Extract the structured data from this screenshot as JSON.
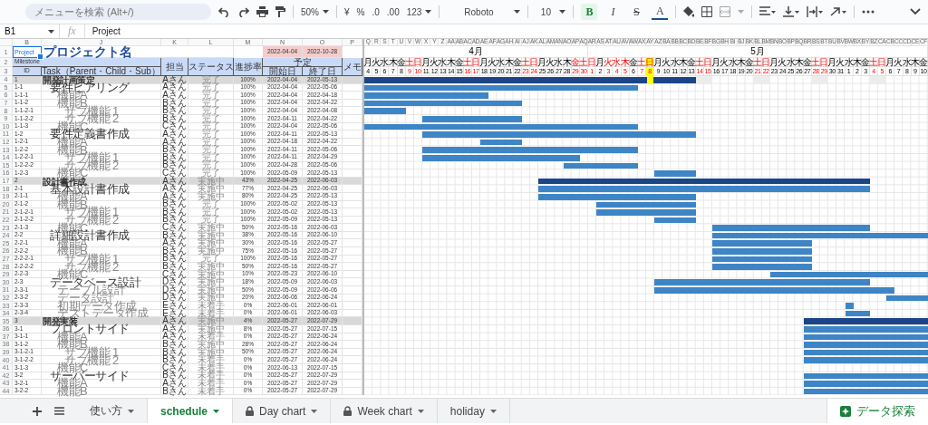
{
  "toolbar": {
    "search_placeholder": "メニューを検索 (Alt+/)",
    "zoom": "50%",
    "number_formats": [
      "¥",
      "%",
      ".0",
      ".00",
      "123"
    ],
    "font": "Roboto",
    "font_size": "10",
    "styles": [
      {
        "kind": "bold",
        "label": "B",
        "on": true
      },
      {
        "kind": "italic",
        "label": "I",
        "on": false
      },
      {
        "kind": "strike",
        "label": "S",
        "on": false
      },
      {
        "kind": "color",
        "label": "A",
        "on": false
      }
    ]
  },
  "formula_bar": {
    "cell": "B1",
    "fx": "fx",
    "value": "Project"
  },
  "column_letters": [
    "B",
    "J",
    "K",
    "L",
    "M",
    "N",
    "O",
    "P"
  ],
  "header": {
    "row_numbers": [
      "1",
      "2",
      "3"
    ],
    "cell": "Project",
    "title": "プロジェクト名",
    "start": "2022-04-04",
    "end": "2022-10-28",
    "milestone": "Milestone",
    "plan": "予定",
    "columns": [
      "ID",
      "Task（Parent・Child・Sub）",
      "担当",
      "ステータス",
      "進捗率",
      "開始日",
      "終了日",
      "メモ"
    ]
  },
  "tasks": [
    {
      "row": "4",
      "id": "1",
      "task": "開発計画策定",
      "owner": "Aさん",
      "status": "完了",
      "progress": "100%",
      "start": "2022-04-04",
      "end": "2022-05-13",
      "children": [
        {
          "row": "5",
          "id": "1-1",
          "task": "要件ヒアリング",
          "owner": "Aさん",
          "status": "完了",
          "progress": "100%",
          "start": "2022-04-04",
          "end": "2022-05-06",
          "children": [
            {
              "row": "6",
              "id": "1-1-1",
              "task": "機能A",
              "owner": "Aさん",
              "status": "完了",
              "progress": "100%",
              "start": "2022-04-04",
              "end": "2022-04-18"
            },
            {
              "row": "7",
              "id": "1-1-2",
              "task": "機能B",
              "owner": "Bさん",
              "status": "完了",
              "progress": "100%",
              "start": "2022-04-04",
              "end": "2022-04-22",
              "children": [
                {
                  "row": "8",
                  "id": "1-1-2-1",
                  "task": "サブ機能 1",
                  "owner": "Bさん",
                  "status": "完了",
                  "progress": "100%",
                  "start": "2022-04-04",
                  "end": "2022-04-08"
                },
                {
                  "row": "9",
                  "id": "1-1-2-2",
                  "task": "サブ機能 2",
                  "owner": "Bさん",
                  "status": "完了",
                  "progress": "100%",
                  "start": "2022-04-11",
                  "end": "2022-04-22"
                }
              ]
            },
            {
              "row": "10",
              "id": "1-1-3",
              "task": "機能C",
              "owner": "Cさん",
              "status": "完了",
              "progress": "100%",
              "start": "2022-04-04",
              "end": "2022-05-06"
            }
          ]
        },
        {
          "row": "11",
          "id": "1-2",
          "task": "要件定義書作成",
          "owner": "Aさん",
          "status": "完了",
          "progress": "100%",
          "start": "2022-04-11",
          "end": "2022-05-13",
          "children": [
            {
              "row": "12",
              "id": "1-2-1",
              "task": "機能A",
              "owner": "Aさん",
              "status": "完了",
              "progress": "100%",
              "start": "2022-04-18",
              "end": "2022-04-22"
            },
            {
              "row": "13",
              "id": "1-2-2",
              "task": "機能B",
              "owner": "Bさん",
              "status": "完了",
              "progress": "100%",
              "start": "2022-04-11",
              "end": "2022-05-06",
              "children": [
                {
                  "row": "14",
                  "id": "1-2-2-1",
                  "task": "サブ機能 1",
                  "owner": "Bさん",
                  "status": "完了",
                  "progress": "100%",
                  "start": "2022-04-11",
                  "end": "2022-04-29"
                },
                {
                  "row": "15",
                  "id": "1-2-2-2",
                  "task": "サブ機能 2",
                  "owner": "Bさん",
                  "status": "完了",
                  "progress": "100%",
                  "start": "2022-04-28",
                  "end": "2022-05-06"
                }
              ]
            },
            {
              "row": "16",
              "id": "1-2-3",
              "task": "機能C",
              "owner": "Cさん",
              "status": "完了",
              "progress": "100%",
              "start": "2022-05-09",
              "end": "2022-05-13"
            }
          ]
        }
      ]
    },
    {
      "row": "17",
      "id": "2",
      "task": "設計書作成",
      "owner": "Aさん",
      "status": "実施中",
      "progress": "43%",
      "start": "2022-04-25",
      "end": "2022-06-03",
      "children": [
        {
          "row": "18",
          "id": "2-1",
          "task": "基本設計書作成",
          "owner": "Aさん",
          "status": "実施中",
          "progress": "77%",
          "start": "2022-04-25",
          "end": "2022-06-03",
          "children": [
            {
              "row": "19",
              "id": "2-1-1",
              "task": "機能A",
              "owner": "Aさん",
              "status": "実施中",
              "progress": "80%",
              "start": "2022-04-25",
              "end": "2022-05-13"
            },
            {
              "row": "20",
              "id": "2-1-2",
              "task": "機能B",
              "owner": "Bさん",
              "status": "完了",
              "progress": "100%",
              "start": "2022-05-02",
              "end": "2022-05-13",
              "children": [
                {
                  "row": "21",
                  "id": "2-1-2-1",
                  "task": "サブ機能 1",
                  "owner": "Bさん",
                  "status": "完了",
                  "progress": "100%",
                  "start": "2022-05-02",
                  "end": "2022-05-13"
                },
                {
                  "row": "22",
                  "id": "2-1-2-2",
                  "task": "サブ機能 2",
                  "owner": "Bさん",
                  "status": "完了",
                  "progress": "100%",
                  "start": "2022-05-09",
                  "end": "2022-05-13"
                }
              ]
            },
            {
              "row": "23",
              "id": "2-1-3",
              "task": "機能C",
              "owner": "Cさん",
              "status": "実施中",
              "progress": "50%",
              "start": "2022-05-16",
              "end": "2022-06-03"
            }
          ]
        },
        {
          "row": "24",
          "id": "2-2",
          "task": "詳細設計書作成",
          "owner": "Bさん",
          "status": "実施中",
          "progress": "38%",
          "start": "2022-05-16",
          "end": "2022-06-10",
          "children": [
            {
              "row": "25",
              "id": "2-2-1",
              "task": "機能A",
              "owner": "Aさん",
              "status": "実施中",
              "progress": "30%",
              "start": "2022-05-16",
              "end": "2022-05-27"
            },
            {
              "row": "26",
              "id": "2-2-2",
              "task": "機能B",
              "owner": "Bさん",
              "status": "実施中",
              "progress": "75%",
              "start": "2022-05-16",
              "end": "2022-05-27",
              "children": [
                {
                  "row": "27",
                  "id": "2-2-2-1",
                  "task": "サブ機能 1",
                  "owner": "Bさん",
                  "status": "完了",
                  "progress": "100%",
                  "start": "2022-05-16",
                  "end": "2022-05-27"
                },
                {
                  "row": "28",
                  "id": "2-2-2-2",
                  "task": "サブ機能 2",
                  "owner": "Bさん",
                  "status": "実施中",
                  "progress": "50%",
                  "start": "2022-05-16",
                  "end": "2022-05-27"
                }
              ]
            },
            {
              "row": "29",
              "id": "2-2-3",
              "task": "機能C",
              "owner": "Cさん",
              "status": "実施中",
              "progress": "10%",
              "start": "2022-05-23",
              "end": "2022-06-10"
            }
          ]
        },
        {
          "row": "30",
          "id": "2-3",
          "task": "データベース設計",
          "owner": "Dさん",
          "status": "実施中",
          "progress": "18%",
          "start": "2022-05-09",
          "end": "2022-06-03",
          "children": [
            {
              "row": "31",
              "id": "2-3-1",
              "task": "テーブル設計",
              "owner": "Dさん",
              "status": "実施中",
              "progress": "50%",
              "start": "2022-05-09",
              "end": "2022-06-06"
            },
            {
              "row": "32",
              "id": "2-3-2",
              "task": "データ設計",
              "owner": "Dさん",
              "status": "実施中",
              "progress": "20%",
              "start": "2022-06-06",
              "end": "2022-06-24"
            },
            {
              "row": "33",
              "id": "2-3-3",
              "task": "初期データ作成",
              "owner": "Eさん",
              "status": "未着手",
              "progress": "0%",
              "start": "2022-06-01",
              "end": "2022-06-01"
            },
            {
              "row": "34",
              "id": "2-3-4",
              "task": "テストデータ作成",
              "owner": "Eさん",
              "status": "未着手",
              "progress": "0%",
              "start": "2022-06-01",
              "end": "2022-06-03"
            }
          ]
        }
      ]
    },
    {
      "row": "35",
      "id": "3",
      "task": "開発実装",
      "owner": "Aさん",
      "status": "実施中",
      "progress": "4%",
      "start": "2022-05-27",
      "end": "2022-07-29",
      "children": [
        {
          "row": "36",
          "id": "3-1",
          "task": "フロントサイド",
          "owner": "Aさん",
          "status": "実施中",
          "progress": "8%",
          "start": "2022-05-27",
          "end": "2022-07-15",
          "children": [
            {
              "row": "37",
              "id": "3-1-1",
              "task": "機能A",
              "owner": "Aさん",
              "status": "未着手",
              "progress": "0%",
              "start": "2022-05-27",
              "end": "2022-06-24"
            },
            {
              "row": "38",
              "id": "3-1-2",
              "task": "機能B",
              "owner": "Bさん",
              "status": "実施中",
              "progress": "28%",
              "start": "2022-05-27",
              "end": "2022-06-24",
              "children": [
                {
                  "row": "39",
                  "id": "3-1-2-1",
                  "task": "サブ機能 1",
                  "owner": "Bさん",
                  "status": "実施中",
                  "progress": "50%",
                  "start": "2022-05-27",
                  "end": "2022-06-24"
                },
                {
                  "row": "40",
                  "id": "3-1-2-2",
                  "task": "サブ機能 2",
                  "owner": "Bさん",
                  "status": "未着手",
                  "progress": "0%",
                  "start": "2022-05-27",
                  "end": "2022-06-24"
                }
              ]
            },
            {
              "row": "41",
              "id": "3-1-3",
              "task": "機能C",
              "owner": "Cさん",
              "status": "未着手",
              "progress": "0%",
              "start": "2022-06-13",
              "end": "2022-07-15"
            }
          ]
        },
        {
          "row": "42",
          "id": "3-2",
          "task": "サーバーサイド",
          "owner": "Bさん",
          "status": "未着手",
          "progress": "0%",
          "start": "2022-05-27",
          "end": "2022-07-29",
          "children": [
            {
              "row": "43",
              "id": "3-2-1",
              "task": "機能A",
              "owner": "Aさん",
              "status": "未着手",
              "progress": "0%",
              "start": "2022-05-27",
              "end": "2022-07-29"
            },
            {
              "row": "44",
              "id": "3-2-2",
              "task": "機能B",
              "owner": "Bさん",
              "status": "未着手",
              "progress": "0%",
              "start": "2022-05-27",
              "end": "2022-07-29"
            }
          ]
        }
      ]
    }
  ],
  "days": [
    {
      "col": "Q",
      "month": "4月",
      "dow": "月",
      "day": "4",
      "off": false,
      "today": false
    },
    {
      "col": "R",
      "dow": "火",
      "day": "5",
      "off": false,
      "today": false
    },
    {
      "col": "S",
      "dow": "水",
      "day": "6",
      "off": false,
      "today": false
    },
    {
      "col": "T",
      "dow": "木",
      "day": "7",
      "off": false,
      "today": false
    },
    {
      "col": "U",
      "dow": "金",
      "day": "8",
      "off": false,
      "today": false
    },
    {
      "col": "V",
      "dow": "土",
      "day": "9",
      "off": true,
      "today": false
    },
    {
      "col": "W",
      "dow": "日",
      "day": "10",
      "off": true,
      "today": false
    },
    {
      "col": "X",
      "dow": "月",
      "day": "11",
      "off": false,
      "today": false
    },
    {
      "col": "Y",
      "dow": "火",
      "day": "12",
      "off": false,
      "today": false
    },
    {
      "col": "Z",
      "dow": "水",
      "day": "13",
      "off": false,
      "today": false
    },
    {
      "col": "AA",
      "dow": "木",
      "day": "14",
      "off": false,
      "today": false
    },
    {
      "col": "AB",
      "dow": "金",
      "day": "15",
      "off": false,
      "today": false
    },
    {
      "col": "AC",
      "dow": "土",
      "day": "16",
      "off": true,
      "today": false
    },
    {
      "col": "AD",
      "dow": "日",
      "day": "17",
      "off": true,
      "today": false
    },
    {
      "col": "AE",
      "dow": "月",
      "day": "18",
      "off": false,
      "today": false
    },
    {
      "col": "AF",
      "dow": "火",
      "day": "19",
      "off": false,
      "today": false
    },
    {
      "col": "AG",
      "dow": "水",
      "day": "20",
      "off": false,
      "today": false
    },
    {
      "col": "AH",
      "dow": "木",
      "day": "21",
      "off": false,
      "today": false
    },
    {
      "col": "AI",
      "dow": "金",
      "day": "22",
      "off": false,
      "today": false
    },
    {
      "col": "AJ",
      "dow": "土",
      "day": "23",
      "off": true,
      "today": false
    },
    {
      "col": "AK",
      "dow": "日",
      "day": "24",
      "off": true,
      "today": false
    },
    {
      "col": "AL",
      "dow": "月",
      "day": "25",
      "off": false,
      "today": false
    },
    {
      "col": "AM",
      "dow": "火",
      "day": "26",
      "off": false,
      "today": false
    },
    {
      "col": "AN",
      "dow": "水",
      "day": "27",
      "off": false,
      "today": false
    },
    {
      "col": "AO",
      "dow": "木",
      "day": "28",
      "off": false,
      "today": false
    },
    {
      "col": "AP",
      "dow": "金",
      "day": "29",
      "off": true,
      "today": false
    },
    {
      "col": "AQ",
      "dow": "土",
      "day": "30",
      "off": true,
      "today": false
    },
    {
      "col": "AR",
      "month": "5月",
      "dow": "日",
      "day": "1",
      "off": true,
      "today": false
    },
    {
      "col": "AS",
      "dow": "月",
      "day": "2",
      "off": false,
      "today": false
    },
    {
      "col": "AT",
      "dow": "火",
      "day": "3",
      "off": true,
      "today": false
    },
    {
      "col": "AU",
      "dow": "水",
      "day": "4",
      "off": true,
      "today": false
    },
    {
      "col": "AV",
      "dow": "木",
      "day": "5",
      "off": true,
      "today": false
    },
    {
      "col": "AW",
      "dow": "金",
      "day": "6",
      "off": false,
      "today": false
    },
    {
      "col": "AX",
      "dow": "土",
      "day": "7",
      "off": true,
      "today": false
    },
    {
      "col": "AY",
      "dow": "日",
      "day": "8",
      "off": true,
      "today": true
    },
    {
      "col": "AZ",
      "dow": "月",
      "day": "9",
      "off": false,
      "today": false
    },
    {
      "col": "BA",
      "dow": "火",
      "day": "10",
      "off": false,
      "today": false
    },
    {
      "col": "BB",
      "dow": "水",
      "day": "11",
      "off": false,
      "today": false
    },
    {
      "col": "BC",
      "dow": "木",
      "day": "12",
      "off": false,
      "today": false
    },
    {
      "col": "BD",
      "dow": "金",
      "day": "13",
      "off": false,
      "today": false
    },
    {
      "col": "BE",
      "dow": "土",
      "day": "14",
      "off": true,
      "today": false
    },
    {
      "col": "BF",
      "dow": "日",
      "day": "15",
      "off": true,
      "today": false
    },
    {
      "col": "BG",
      "dow": "月",
      "day": "16",
      "off": false,
      "today": false
    },
    {
      "col": "BH",
      "dow": "火",
      "day": "17",
      "off": false,
      "today": false
    },
    {
      "col": "BI",
      "dow": "水",
      "day": "18",
      "off": false,
      "today": false
    },
    {
      "col": "BJ",
      "dow": "木",
      "day": "19",
      "off": false,
      "today": false
    },
    {
      "col": "BK",
      "dow": "金",
      "day": "20",
      "off": false,
      "today": false
    },
    {
      "col": "BL",
      "dow": "土",
      "day": "21",
      "off": true,
      "today": false
    },
    {
      "col": "BM",
      "dow": "日",
      "day": "22",
      "off": true,
      "today": false
    },
    {
      "col": "BN",
      "dow": "月",
      "day": "23",
      "off": false,
      "today": false
    },
    {
      "col": "BO",
      "dow": "火",
      "day": "24",
      "off": false,
      "today": false
    },
    {
      "col": "BP",
      "dow": "水",
      "day": "25",
      "off": false,
      "today": false
    },
    {
      "col": "BQ",
      "dow": "木",
      "day": "26",
      "off": false,
      "today": false
    },
    {
      "col": "BR",
      "dow": "金",
      "day": "27",
      "off": false,
      "today": false
    },
    {
      "col": "BS",
      "dow": "土",
      "day": "28",
      "off": true,
      "today": false
    },
    {
      "col": "BT",
      "dow": "日",
      "day": "29",
      "off": true,
      "today": false
    },
    {
      "col": "BU",
      "dow": "月",
      "day": "30",
      "off": false,
      "today": false
    },
    {
      "col": "BV",
      "dow": "火",
      "day": "31",
      "off": false,
      "today": false
    },
    {
      "col": "BW",
      "dow": "水",
      "day": "1",
      "off": false,
      "today": false
    },
    {
      "col": "BX",
      "dow": "木",
      "day": "2",
      "off": false,
      "today": false
    },
    {
      "col": "BY",
      "dow": "金",
      "day": "3",
      "off": false,
      "today": false
    },
    {
      "col": "BZ",
      "dow": "土",
      "day": "4",
      "off": true,
      "today": false
    },
    {
      "col": "CA",
      "dow": "日",
      "day": "5",
      "off": true,
      "today": false
    },
    {
      "col": "CB",
      "dow": "月",
      "day": "6",
      "off": false,
      "today": false
    },
    {
      "col": "CC",
      "dow": "火",
      "day": "7",
      "off": false,
      "today": false
    },
    {
      "col": "CD",
      "dow": "水",
      "day": "8",
      "off": false,
      "today": false
    },
    {
      "col": "CE",
      "dow": "木",
      "day": "9",
      "off": false,
      "today": false
    },
    {
      "col": "CF",
      "dow": "金",
      "day": "10",
      "off": false,
      "today": false
    }
  ],
  "sheet_tabs": [
    {
      "label": "使い方",
      "locked": false,
      "selected": false
    },
    {
      "label": "schedule",
      "locked": false,
      "selected": true
    },
    {
      "label": "Day chart",
      "locked": true,
      "selected": false
    },
    {
      "label": "Week chart",
      "locked": true,
      "selected": false
    },
    {
      "label": "holiday",
      "locked": false,
      "selected": false
    }
  ],
  "explore": "データ探索"
}
